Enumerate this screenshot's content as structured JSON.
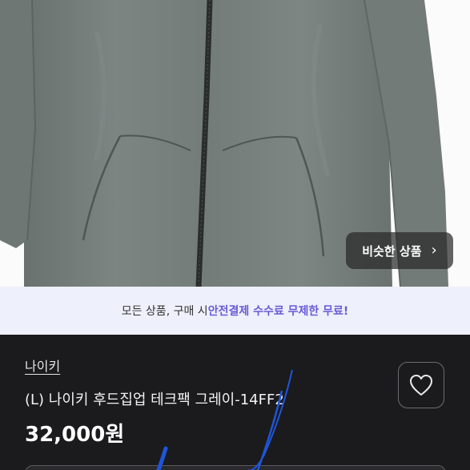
{
  "product_image": {
    "alt_icon": "gray-hoodie-photo"
  },
  "similar_products": {
    "label": "비슷한 상품",
    "chevron": "›"
  },
  "promo": {
    "prefix": "모든 상품, 구매 시 ",
    "highlight": "안전결제 수수료 무제한 무료!"
  },
  "product": {
    "shop_name": "나이키",
    "title": "(L) 나이키 후드집업 테크팩 그레이-14FF2",
    "price": "32,000원"
  },
  "colors": {
    "accent": "#6a5ad8",
    "promo_bg": "#eef0fb",
    "info_bg": "#1b1b1d",
    "scribble": "#1f55d9"
  },
  "icons": {
    "favorite": "heart-icon"
  }
}
